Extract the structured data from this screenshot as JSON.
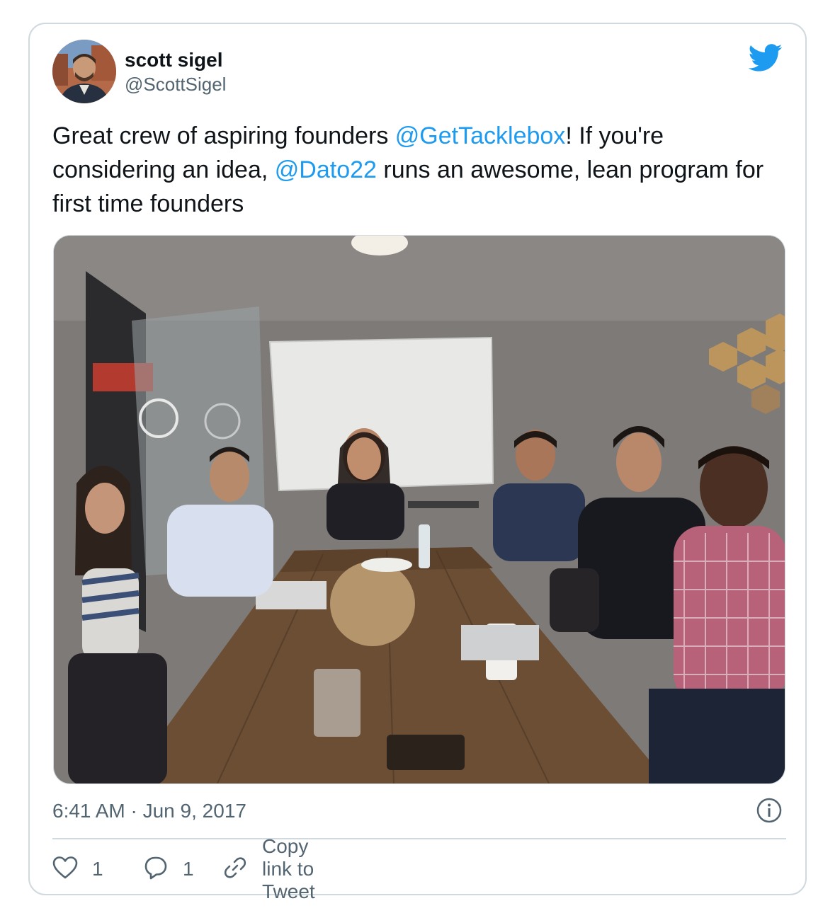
{
  "author": {
    "display_name": "scott sigel",
    "handle": "@ScottSigel"
  },
  "tweet": {
    "text_part1": "Great crew of aspiring founders ",
    "mention1": "@GetTacklebox",
    "text_part2": "! If you're considering an idea, ",
    "mention2": "@Dato22",
    "text_part3": " runs an awesome, lean program for first time founders",
    "timestamp": "6:41 AM · Jun 9, 2017"
  },
  "actions": {
    "like_count": "1",
    "reply_count": "1",
    "copy_link_label": "Copy link to Tweet"
  },
  "icons": {
    "brand": "twitter-bird-icon",
    "info": "info-icon",
    "like": "heart-icon",
    "reply": "reply-bubble-icon",
    "copy": "link-icon"
  },
  "colors": {
    "link": "#1d9bf0",
    "secondary_text": "#536471",
    "border": "#cfd9de"
  }
}
